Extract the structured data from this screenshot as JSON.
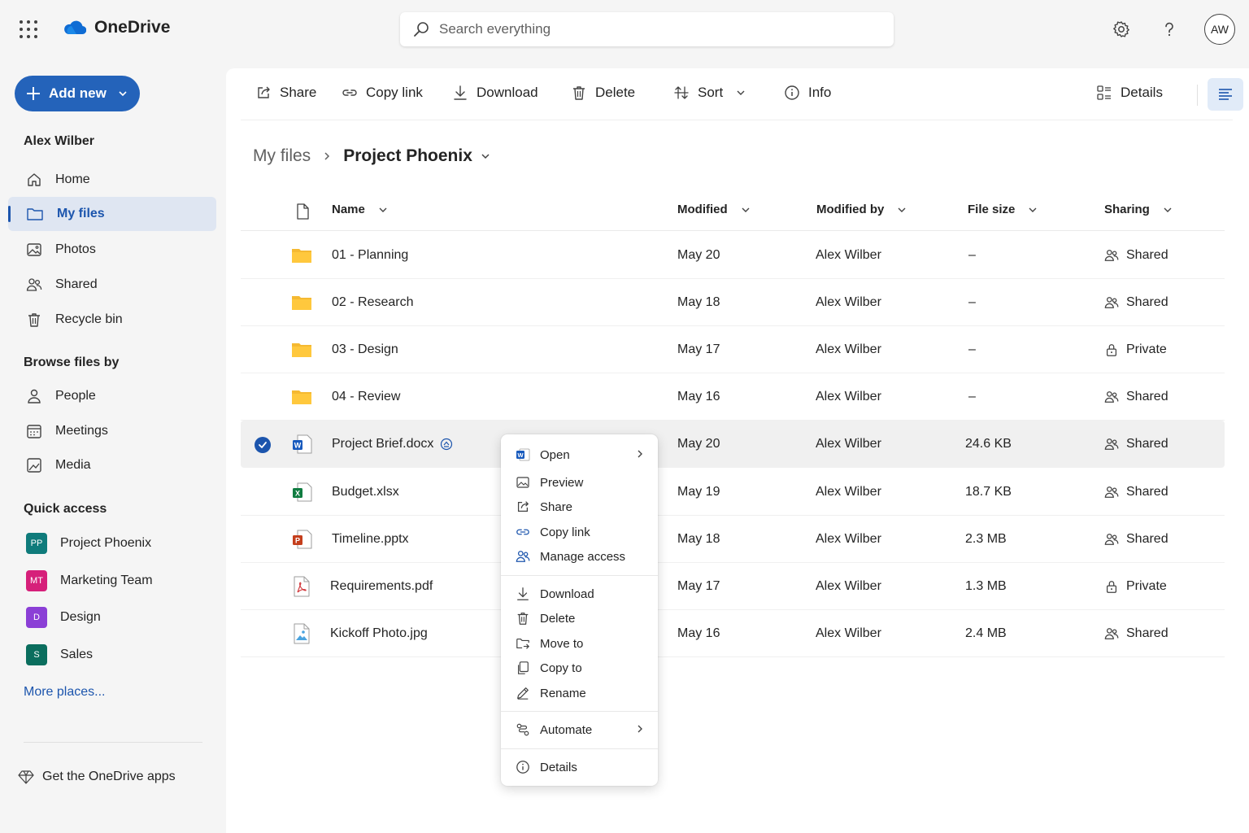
{
  "app": {
    "title": "OneDrive"
  },
  "search": {
    "placeholder": "Search everything"
  },
  "user": {
    "initials": "AW",
    "name": "Alex Wilber"
  },
  "sidebar": {
    "add_new": "Add new",
    "nav": [
      {
        "label": "Home",
        "icon": "home-icon"
      },
      {
        "label": "My files",
        "icon": "folder-icon",
        "active": true
      },
      {
        "label": "Photos",
        "icon": "photos-icon"
      },
      {
        "label": "Shared",
        "icon": "people-icon"
      },
      {
        "label": "Recycle bin",
        "icon": "trash-icon"
      }
    ],
    "browse_heading": "Browse files by",
    "browse": [
      {
        "label": "People",
        "icon": "person-icon"
      },
      {
        "label": "Meetings",
        "icon": "calendar-icon"
      },
      {
        "label": "Media",
        "icon": "media-icon"
      }
    ],
    "quick_access_heading": "Quick access",
    "quick_access": [
      {
        "label": "Project Phoenix",
        "badge": "PP",
        "color": "#0f7b7b"
      },
      {
        "label": "Marketing Team",
        "badge": "MT",
        "color": "#d6207a"
      },
      {
        "label": "Design",
        "badge": "D",
        "color": "#8b3fd6"
      },
      {
        "label": "Sales",
        "badge": "S",
        "color": "#0b6e5e"
      }
    ],
    "more_places": "More places...",
    "get_apps": "Get the OneDrive apps"
  },
  "toolbar": {
    "share": "Share",
    "copy_link": "Copy link",
    "download": "Download",
    "delete": "Delete",
    "sort": "Sort",
    "info": "Info",
    "details": "Details"
  },
  "breadcrumb": {
    "root": "My files",
    "current": "Project Phoenix"
  },
  "table": {
    "headers": {
      "name": "Name",
      "modified": "Modified",
      "modified_by": "Modified by",
      "file_size": "File size",
      "sharing": "Sharing"
    },
    "rows": [
      {
        "name": "01 - Planning",
        "type": "folder",
        "modified": "May 20",
        "modified_by": "Alex Wilber",
        "size": "–",
        "sharing": "Shared"
      },
      {
        "name": "02 - Research",
        "type": "folder",
        "modified": "May 18",
        "modified_by": "Alex Wilber",
        "size": "–",
        "sharing": "Shared"
      },
      {
        "name": "03 - Design",
        "type": "folder",
        "modified": "May 17",
        "modified_by": "Alex Wilber",
        "size": "–",
        "sharing": "Private"
      },
      {
        "name": "04 - Review",
        "type": "folder",
        "modified": "May 16",
        "modified_by": "Alex Wilber",
        "size": "–",
        "sharing": "Shared"
      },
      {
        "name": "Project Brief.docx",
        "type": "word",
        "modified": "May 20",
        "modified_by": "Alex Wilber",
        "size": "24.6 KB",
        "sharing": "Shared",
        "selected": true
      },
      {
        "name": "Budget.xlsx",
        "type": "excel",
        "modified": "May 19",
        "modified_by": "Alex Wilber",
        "size": "18.7 KB",
        "sharing": "Shared"
      },
      {
        "name": "Timeline.pptx",
        "type": "powerpoint",
        "modified": "May 18",
        "modified_by": "Alex Wilber",
        "size": "2.3 MB",
        "sharing": "Shared"
      },
      {
        "name": "Requirements.pdf",
        "type": "pdf",
        "modified": "May 17",
        "modified_by": "Alex Wilber",
        "size": "1.3 MB",
        "sharing": "Private"
      },
      {
        "name": "Kickoff Photo.jpg",
        "type": "image",
        "modified": "May 16",
        "modified_by": "Alex Wilber",
        "size": "2.4 MB",
        "sharing": "Shared"
      }
    ]
  },
  "context_menu": {
    "open": "Open",
    "preview": "Preview",
    "share": "Share",
    "copy_link": "Copy link",
    "manage_access": "Manage access",
    "download": "Download",
    "delete": "Delete",
    "move_to": "Move to",
    "copy_to": "Copy to",
    "rename": "Rename",
    "automate": "Automate",
    "details": "Details"
  },
  "colors": {
    "accent": "#1c55ad",
    "add_new_bg": "#2463ba",
    "folder": "#f5b932",
    "word": "#185abd",
    "excel": "#107c41",
    "powerpoint": "#c43e1c",
    "pdf": "#d13438"
  }
}
